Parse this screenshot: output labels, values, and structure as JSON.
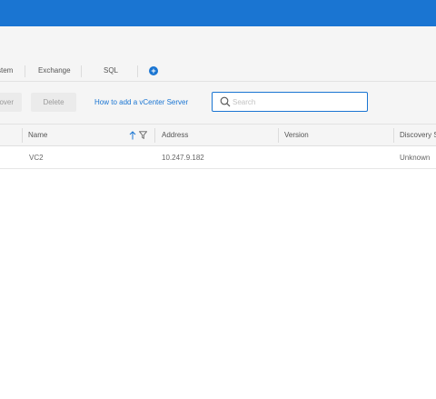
{
  "tabs": {
    "items": [
      {
        "label": "stem"
      },
      {
        "label": "Exchange"
      },
      {
        "label": "SQL"
      }
    ]
  },
  "toolbar": {
    "discover_label": "over",
    "delete_label": "Delete",
    "help_link": "How to add a vCenter Server",
    "search_placeholder": "Search"
  },
  "table": {
    "columns": [
      "Name",
      "Address",
      "Version",
      "Discovery St"
    ],
    "rows": [
      {
        "name": "VC2",
        "address": "10.247.9.182",
        "version": "",
        "discovery_status": "Unknown"
      }
    ]
  },
  "colors": {
    "topbar": "#1a75d2",
    "accent": "#1a75d2"
  }
}
